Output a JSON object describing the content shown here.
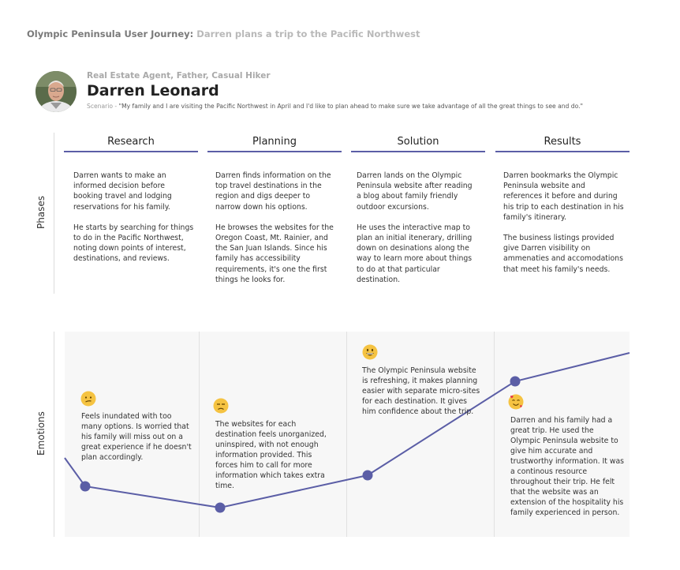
{
  "header": {
    "title_prefix": "Olympic Peninsula User Journey:",
    "title_suffix": "Darren plans a trip to the Pacific Northwest"
  },
  "persona": {
    "role": "Real Estate Agent, Father, Casual Hiker",
    "name": "Darren Leonard",
    "scenario_label": "Scenario -",
    "scenario_quote": "\"My family and I are visiting the Pacific Northwest in April and I'd like to plan ahead to make sure we take advantage of all the great things to see and do.\""
  },
  "row_labels": {
    "phases": "Phases",
    "emotions": "Emotions"
  },
  "phases": [
    {
      "title": "Research",
      "p1": "Darren wants to make an informed decision before booking travel and lodging reservations for his family.",
      "p2": "He starts by searching for things to do in the Pacific Northwest, noting down points of interest, destinations, and reviews."
    },
    {
      "title": "Planning",
      "p1": "Darren finds information on the top travel destinations in the region and digs deeper to narrow down his options.",
      "p2": "He browses the websites for the Oregon Coast, Mt. Rainier, and the San Juan Islands. Since his family has accessibility requirements, it's one the first things he looks for."
    },
    {
      "title": "Solution",
      "p1": "Darren lands on the Olympic Peninsula website after reading a blog about family friendly outdoor excursions.",
      "p2": "He uses the interactive map to plan an initial itenerary, drilling down on desinations along the way to learn more about things to do at that particular destination."
    },
    {
      "title": "Results",
      "p1": "Darren bookmarks the Olympic Peninsula website and references it before and during his trip to each destination in his family's itinerary.",
      "p2": "The business listings provided give Darren visibility on ammenaties and accomodations that meet his family's needs."
    }
  ],
  "emotions": [
    {
      "icon": "confused-face-icon",
      "text": "Feels inundated with too many options. Is worried that his family will miss out on a great experience if he doesn't plan accordingly."
    },
    {
      "icon": "unamused-face-icon",
      "text": "The websites for each destination feels unorganized, uninspired, with not enough information provided. This forces him to call for more information which takes extra time."
    },
    {
      "icon": "grinning-face-icon",
      "text": "The Olympic Peninsula website is refreshing, it makes planning easier with separate micro-sites for each destination. It gives him confidence about the trip."
    },
    {
      "icon": "smiling-face-with-hearts-icon",
      "text": "Darren and his family had a great trip. He used the Olympic Peninsula website to give him accurate and trustworthy information. It was a continous resource throughout their trip. He felt that the website was an extension of the hospitality his family experienced in person."
    }
  ],
  "colors": {
    "accent": "#5b5ea6",
    "emoji": "#f5c342",
    "emotion_bg": "#f7f7f7"
  }
}
